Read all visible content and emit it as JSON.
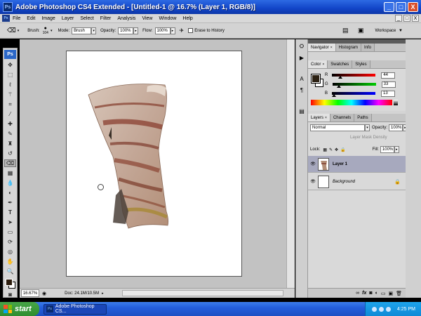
{
  "window": {
    "title": "Adobe Photoshop CS4 Extended - [Untitled-1 @ 16.7% (Layer 1, RGB/8)]",
    "app_icon": "Ps",
    "controls": [
      "_",
      "□",
      "X"
    ]
  },
  "menubar": {
    "logo": "Ps",
    "items": [
      "File",
      "Edit",
      "Image",
      "Layer",
      "Select",
      "Filter",
      "Analysis",
      "View",
      "Window",
      "Help"
    ],
    "doc_controls": [
      "_",
      "□",
      "X"
    ]
  },
  "options": {
    "brush_label": "Brush:",
    "brush_size": "104",
    "mode_label": "Mode:",
    "mode_value": "Brush",
    "opacity_label": "Opacity:",
    "opacity_value": "100%",
    "flow_label": "Flow:",
    "flow_value": "100%",
    "erase_history_label": "Erase to History",
    "workspace_label": "Workspace"
  },
  "toolbox": {
    "logo": "Ps",
    "tools": [
      "move-tool",
      "marquee-tool",
      "lasso-tool",
      "quick-select-tool",
      "crop-tool",
      "eyedropper-tool",
      "healing-tool",
      "brush-tool",
      "clone-stamp-tool",
      "history-brush-tool",
      "eraser-tool",
      "gradient-tool",
      "blur-tool",
      "dodge-tool",
      "pen-tool",
      "type-tool",
      "path-select-tool",
      "shape-tool",
      "3d-rotate-tool",
      "3d-orbit-tool",
      "hand-tool",
      "zoom-tool"
    ],
    "selected_tool": "eraser-tool"
  },
  "status": {
    "zoom": "16.67%",
    "doc": "Doc: 24.1M/10.5M"
  },
  "panels": {
    "nav_tabs": [
      "Navigator",
      "Histogram",
      "Info"
    ],
    "color_tabs": [
      "Color",
      "Swatches",
      "Styles"
    ],
    "color": {
      "r_label": "R",
      "r_value": "44",
      "g_label": "G",
      "g_value": "33",
      "b_label": "B",
      "b_value": "13",
      "foreground_color": "#2c210d"
    },
    "layer_tabs": [
      "Layers",
      "Channels",
      "Paths"
    ],
    "layers": {
      "blend_mode": "Normal",
      "opacity_label": "Opacity:",
      "opacity_value": "100%",
      "mask_density_label": "Layer Mask Density",
      "lock_label": "Lock:",
      "fill_label": "Fill:",
      "fill_value": "100%",
      "items": [
        {
          "name": "Layer 1",
          "selected": true
        },
        {
          "name": "Background",
          "selected": false
        }
      ],
      "footer_icons": [
        "link-icon",
        "fx-icon",
        "mask-icon",
        "adjustment-icon",
        "group-icon",
        "new-layer-icon",
        "trash-icon"
      ]
    }
  },
  "taskbar": {
    "start_label": "start",
    "task_label": "Adobe Photoshop CS...",
    "clock": "4:25 PM"
  }
}
